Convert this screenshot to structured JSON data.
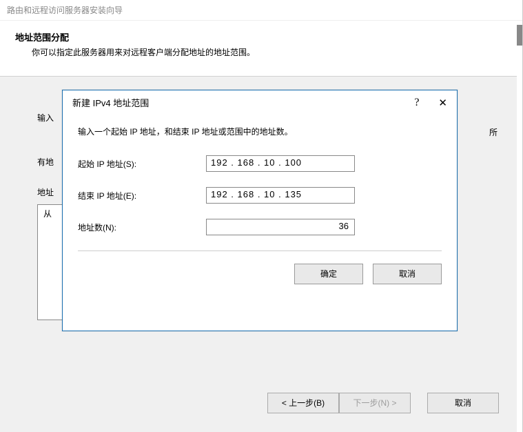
{
  "wizard": {
    "window_title": "路由和远程访问服务器安装向导",
    "heading": "地址范围分配",
    "subheading": "你可以指定此服务器用来对远程客户端分配地址的地址范围。",
    "body_intro_1": "输入",
    "body_intro_2": "所",
    "body_line2_1": "有地",
    "body_line3_1": "地址",
    "list_header": "从",
    "back_btn": "< 上一步(B)",
    "next_btn": "下一步(N) >",
    "cancel_btn": "取消"
  },
  "dialog": {
    "title": "新建 IPv4 地址范围",
    "help_symbol": "?",
    "close_symbol": "✕",
    "instruction": "输入一个起始 IP 地址，和结束 IP 地址或范围中的地址数。",
    "start_label": "起始 IP 地址(S):",
    "end_label": "结束 IP 地址(E):",
    "count_label": "地址数(N):",
    "start_value": "192 . 168 .  10  . 100",
    "end_value": "192 . 168 .  10  . 135",
    "count_value": "36",
    "ok": "确定",
    "cancel": "取消"
  }
}
